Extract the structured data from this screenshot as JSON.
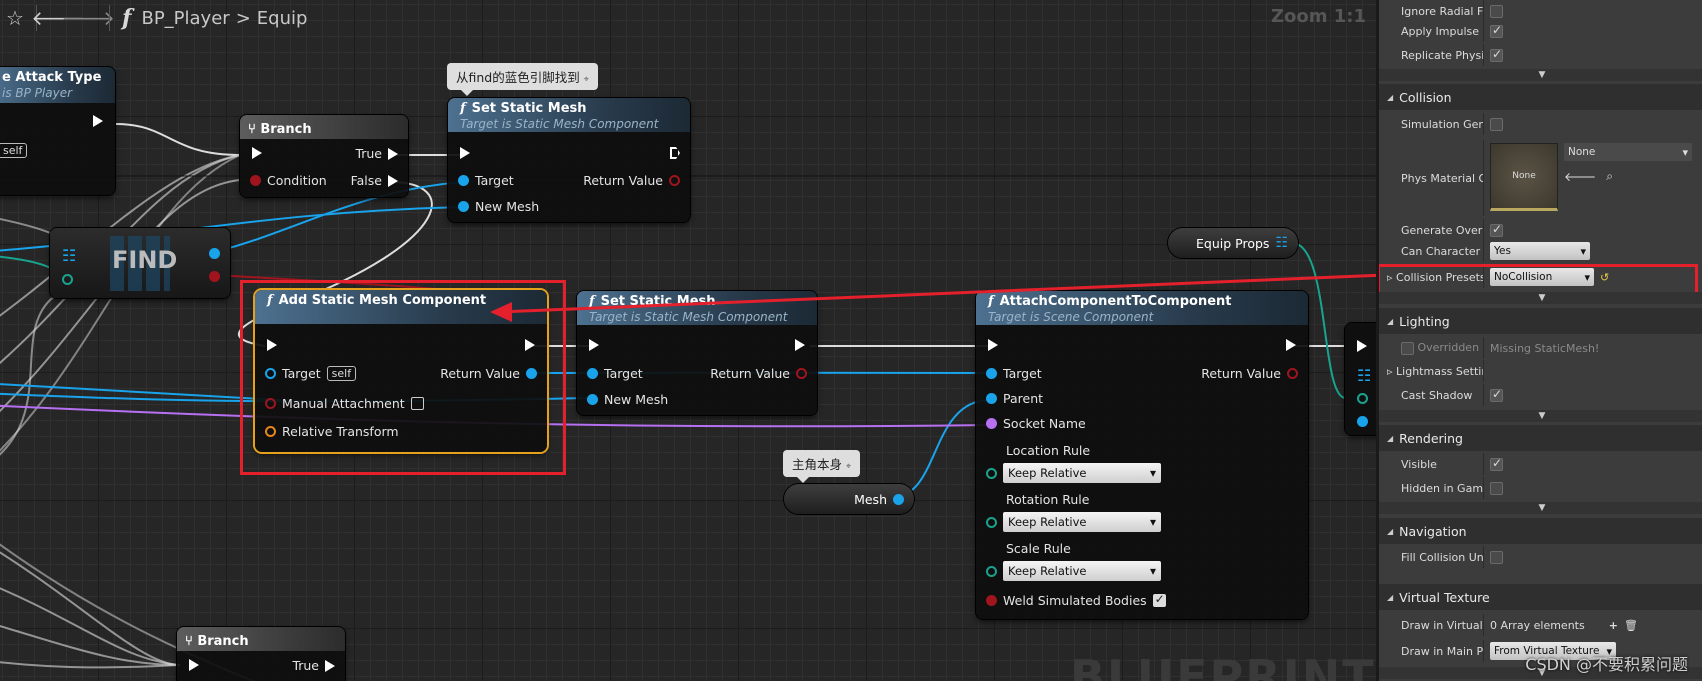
{
  "toolbar": {
    "fn_glyph": "f",
    "blueprint": "BP_Player",
    "separator": ">",
    "graph": "Equip",
    "zoom": "Zoom 1:1"
  },
  "watermark": "BLUEPRINT",
  "nodes": {
    "cast": {
      "title": "e Attack Type",
      "subtitle": "is BP Player",
      "self": "self"
    },
    "branch1": {
      "title": "Branch",
      "true": "True",
      "false": "False",
      "condition": "Condition"
    },
    "set_mesh1": {
      "title": "Set Static Mesh",
      "subtitle": "Target is Static Mesh Component",
      "target": "Target",
      "new_mesh": "New Mesh",
      "return": "Return Value"
    },
    "find": {
      "title": "FIND"
    },
    "add_mesh": {
      "title": "Add Static Mesh Component",
      "target": "Target",
      "self": "self",
      "return": "Return Value",
      "manual": "Manual Attachment",
      "relative": "Relative Transform"
    },
    "set_mesh2": {
      "title": "Set Static Mesh",
      "subtitle": "Target is Static Mesh Component",
      "target": "Target",
      "new_mesh": "New Mesh",
      "return": "Return Value"
    },
    "attach": {
      "title": "AttachComponentToComponent",
      "subtitle": "Target is Scene Component",
      "target": "Target",
      "parent": "Parent",
      "socket": "Socket Name",
      "location": "Location Rule",
      "rotation": "Rotation Rule",
      "scale": "Scale Rule",
      "rule_value": "Keep Relative",
      "weld": "Weld Simulated Bodies",
      "return": "Return Value"
    },
    "branch2": {
      "title": "Branch",
      "true": "True"
    }
  },
  "comments": {
    "find_hint": "从find的蓝色引脚找到",
    "self_hint": "主角本身"
  },
  "vars": {
    "equip_props": "Equip Props",
    "mesh": "Mesh"
  },
  "panel": {
    "ignore_radial": "Ignore Radial Force",
    "apply_impulse": "Apply Impulse on D",
    "replicate_physics": "Replicate Physics t",
    "collision": "Collision",
    "sim_generates": "Simulation Generat",
    "phys_material": "Phys Material Over",
    "thumb_none": "None",
    "phys_value": "None",
    "gen_overlap": "Generate Overlap E",
    "can_step": "Can Character Step",
    "can_step_value": "Yes",
    "presets": "Collision Presets",
    "presets_value": "NoCollision",
    "lighting": "Lighting",
    "overridden": "Overridden Ligh",
    "missing": "Missing StaticMesh!",
    "lightmass": "Lightmass Settings",
    "cast_shadow": "Cast Shadow",
    "rendering": "Rendering",
    "visible": "Visible",
    "hidden": "Hidden in Game",
    "navigation": "Navigation",
    "fill_collision": "Fill Collision Underr",
    "virtual_texture": "Virtual Texture",
    "draw_in_vt": "Draw in Virtual Text",
    "array_elements": "0 Array elements",
    "draw_main": "Draw in Main Pass",
    "draw_main_value": "From Virtual Texture"
  },
  "csdn": "CSDN @不要积累问题",
  "colors": {
    "exec": "#ffffff",
    "object_pin": "#19a3ea",
    "highlight": "#e3202b",
    "name_pin": "#b770f1",
    "selected": "#e6a11c"
  }
}
